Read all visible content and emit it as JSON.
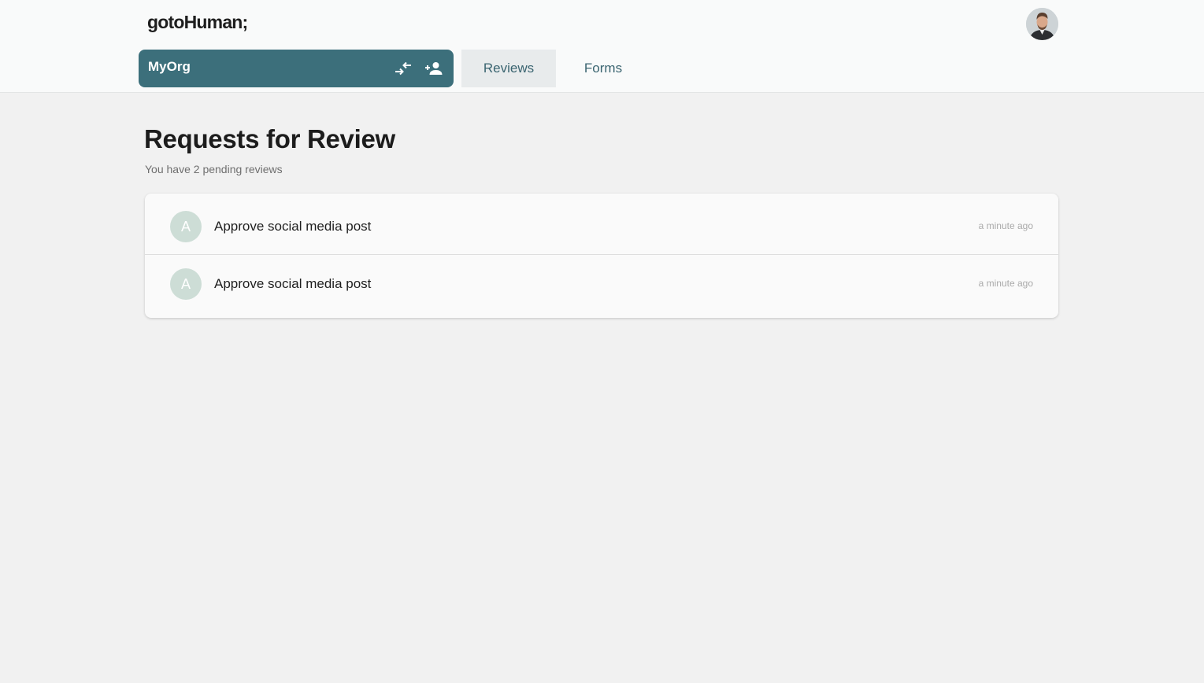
{
  "header": {
    "logo": "gotoHuman;",
    "avatar_icon": "user-profile-photo"
  },
  "org": {
    "name": "MyOrg",
    "switch_icon": "swap-arrows-icon",
    "add_member_icon": "person-add-icon",
    "color": "#3c6f7b"
  },
  "tabs": [
    {
      "label": "Reviews",
      "active": true
    },
    {
      "label": "Forms",
      "active": false
    }
  ],
  "main": {
    "title": "Requests for Review",
    "subtitle": "You have 2 pending reviews",
    "reviews": [
      {
        "avatar_letter": "A",
        "title": "Approve social media post",
        "time": "a minute ago"
      },
      {
        "avatar_letter": "A",
        "title": "Approve social media post",
        "time": "a minute ago"
      }
    ]
  }
}
